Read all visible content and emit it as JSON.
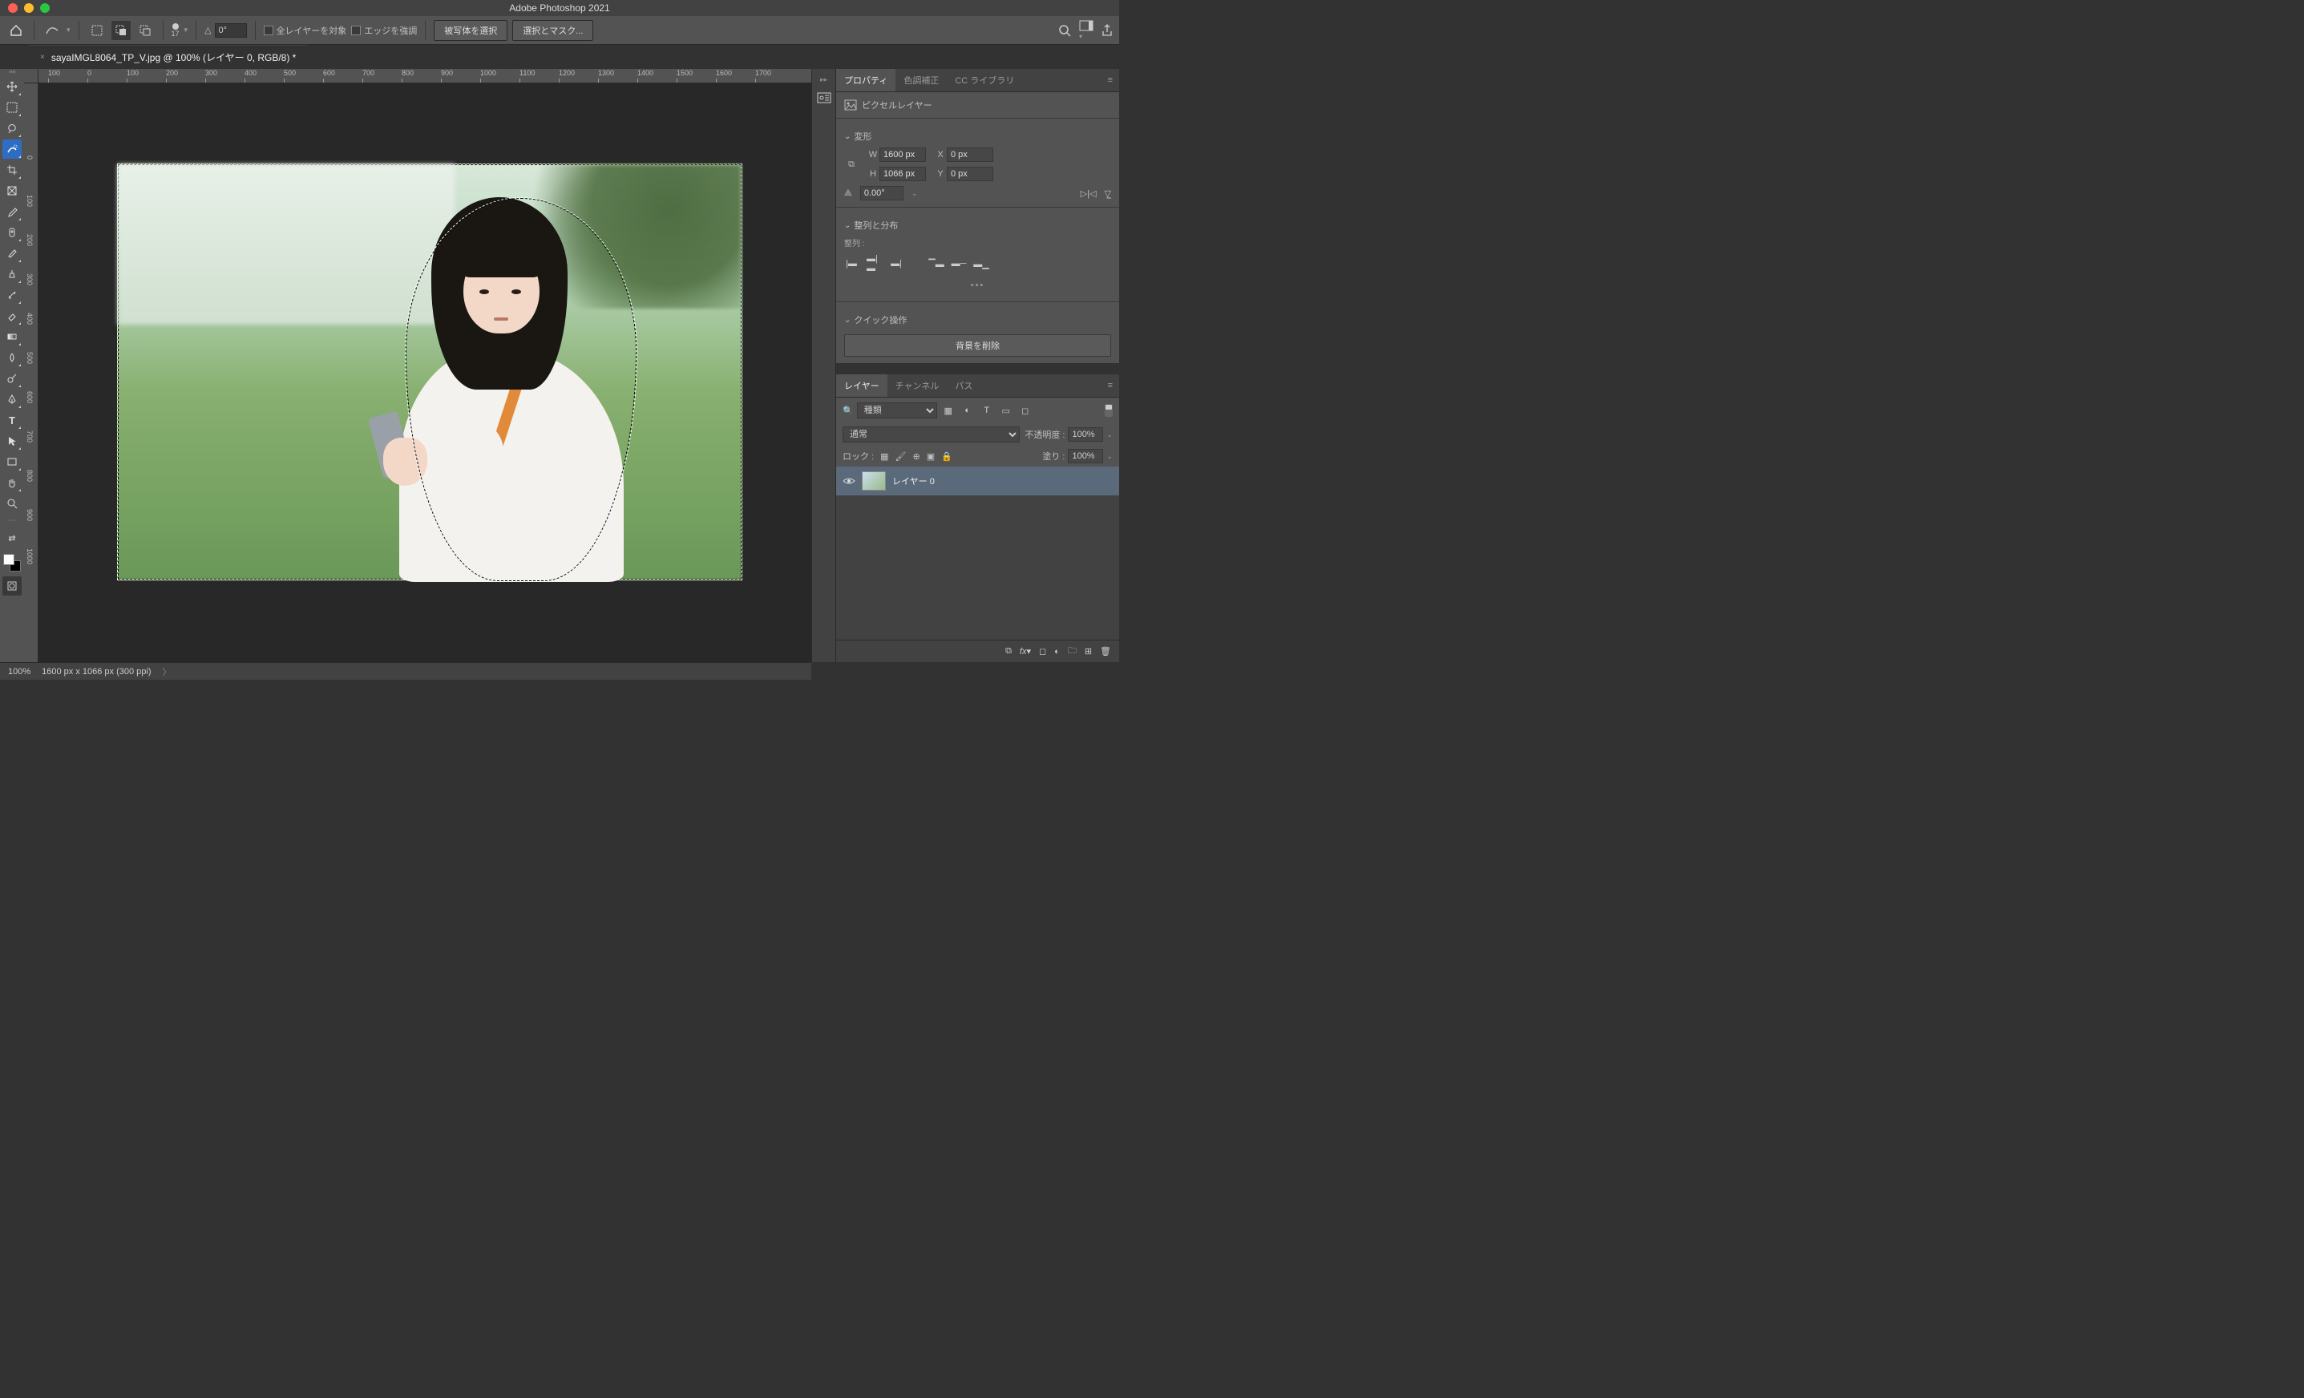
{
  "app": {
    "title": "Adobe Photoshop 2021"
  },
  "tab": {
    "label": "sayaIMGL8064_TP_V.jpg @ 100% (レイヤー 0, RGB/8) *"
  },
  "options": {
    "brush_size": "17",
    "angle_symbol": "△",
    "angle_value": "0°",
    "all_layers_label": "全レイヤーを対象",
    "enhance_edge_label": "エッジを強調",
    "select_subject_label": "被写体を選択",
    "select_and_mask_label": "選択とマスク..."
  },
  "ruler_h": [
    "100",
    "0",
    "100",
    "200",
    "300",
    "400",
    "500",
    "600",
    "700",
    "800",
    "900",
    "1000",
    "1100",
    "1200",
    "1300",
    "1400",
    "1500",
    "1600",
    "1700"
  ],
  "ruler_v": [
    "0",
    "100",
    "200",
    "300",
    "400",
    "500",
    "600",
    "700",
    "800",
    "900",
    "1000"
  ],
  "properties": {
    "tab_properties": "プロパティ",
    "tab_adjustments": "色調補正",
    "tab_cclib": "CC ライブラリ",
    "layer_type_label": "ピクセルレイヤー",
    "transform_label": "変形",
    "w_label": "W",
    "w_value": "1600 px",
    "h_label": "H",
    "h_value": "1066 px",
    "x_label": "X",
    "x_value": "0 px",
    "y_label": "Y",
    "y_value": "0 px",
    "rot_value": "0.00°",
    "align_label": "整列と分布",
    "align_sub_label": "整列 :",
    "quick_ops_label": "クイック操作",
    "remove_bg_label": "背景を削除"
  },
  "layers": {
    "tab_layers": "レイヤー",
    "tab_channels": "チャンネル",
    "tab_paths": "パス",
    "filter_kind": "種類",
    "blend_mode": "通常",
    "opacity_label": "不透明度 :",
    "opacity_value": "100%",
    "lock_label": "ロック :",
    "fill_label": "塗り :",
    "fill_value": "100%",
    "layer0_name": "レイヤー 0"
  },
  "status": {
    "zoom": "100%",
    "docinfo": "1600 px x 1066 px (300 ppi)"
  }
}
